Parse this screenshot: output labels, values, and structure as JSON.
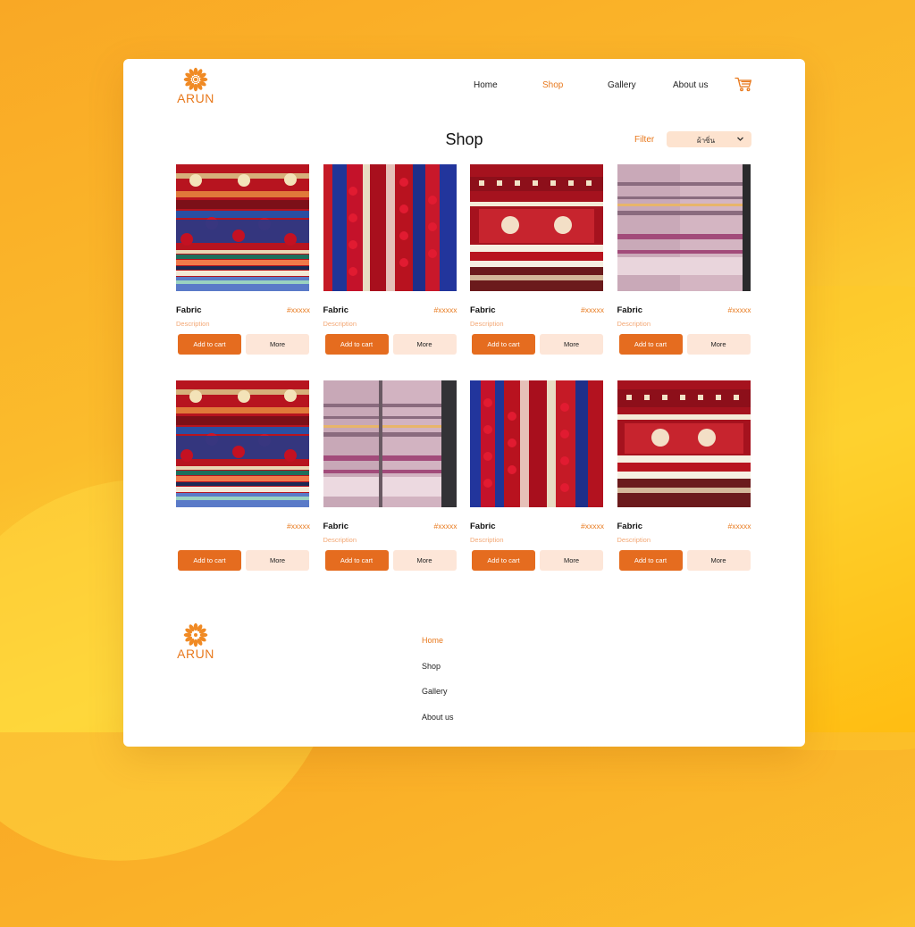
{
  "brand": {
    "name": "ARUN"
  },
  "nav": {
    "home": "Home",
    "shop": "Shop",
    "gallery": "Gallery",
    "about": "About us",
    "active": "Shop"
  },
  "page": {
    "title": "Shop",
    "filter_label": "Filter",
    "filter_value": "ผ้าซิ่น"
  },
  "products": [
    {
      "name": "Fabric",
      "price": "#xxxxx",
      "description": "Description",
      "image": "pompom-textile-icon"
    },
    {
      "name": "Fabric",
      "price": "#xxxxx",
      "description": "Description",
      "image": "striped-tassel-textile-icon"
    },
    {
      "name": "Fabric",
      "price": "#xxxxx",
      "description": "Description",
      "image": "red-fringe-textile-icon"
    },
    {
      "name": "Fabric",
      "price": "#xxxxx",
      "description": "Description",
      "image": "pink-scarf-textile-icon"
    },
    {
      "name": "",
      "price": "#xxxxx",
      "description": "",
      "image": "pompom-textile-icon"
    },
    {
      "name": "Fabric",
      "price": "#xxxxx",
      "description": "Description",
      "image": "pink-scarf-textile-icon"
    },
    {
      "name": "Fabric",
      "price": "#xxxxx",
      "description": "Description",
      "image": "striped-tassel-textile-icon"
    },
    {
      "name": "Fabric",
      "price": "#xxxxx",
      "description": "Description",
      "image": "red-fringe-textile-icon"
    }
  ],
  "buttons": {
    "add_to_cart": "Add to cart",
    "more": "More"
  },
  "footer": {
    "links": [
      "Home",
      "Shop",
      "Gallery",
      "About us"
    ],
    "active": "Home"
  },
  "colors": {
    "accent": "#e8791d",
    "button": "#e56c1f",
    "button_secondary": "#fde6d8"
  }
}
